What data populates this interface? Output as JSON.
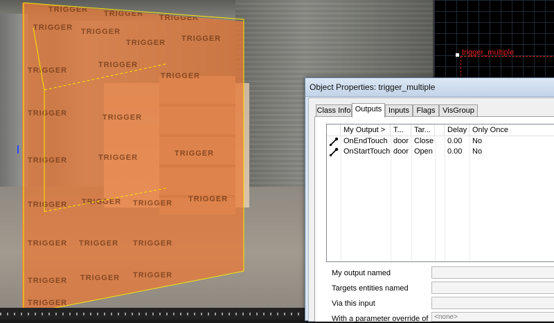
{
  "viewport2d": {
    "object_label": "trigger_multiple"
  },
  "viewport3d": {
    "texture_label": "TRIGGER"
  },
  "dialog": {
    "title": "Object Properties: trigger_multiple",
    "tabs": [
      {
        "label": "Class Info",
        "active": false
      },
      {
        "label": "Outputs",
        "active": true
      },
      {
        "label": "Inputs",
        "active": false
      },
      {
        "label": "Flags",
        "active": false
      },
      {
        "label": "VisGroup",
        "active": false
      }
    ],
    "outputs_table": {
      "columns": [
        "My Output  >",
        "T...",
        "Tar...",
        "Delay",
        "Only Once"
      ],
      "rows": [
        {
          "icon": "output-connection-icon",
          "output": "OnEndTouch",
          "target": "door",
          "input": "Close",
          "delay": "0.00",
          "once": "No"
        },
        {
          "icon": "output-connection-icon",
          "output": "OnStartTouch",
          "target": "door",
          "input": "Open",
          "delay": "0.00",
          "once": "No"
        }
      ]
    },
    "properties": {
      "my_output_named": {
        "label": "My output named",
        "value": ""
      },
      "targets_entities_named": {
        "label": "Targets entities named",
        "value": ""
      },
      "via_this_input": {
        "label": "Via this input",
        "value": ""
      },
      "parameter_override": {
        "label": "With a parameter override of",
        "value": "<none>"
      }
    }
  },
  "colors": {
    "trigger_brush": "#ec7834",
    "selection_outline": "#ffe400",
    "object_2d": "#e02020",
    "dialog_title_bg": "#c3d4e8"
  }
}
